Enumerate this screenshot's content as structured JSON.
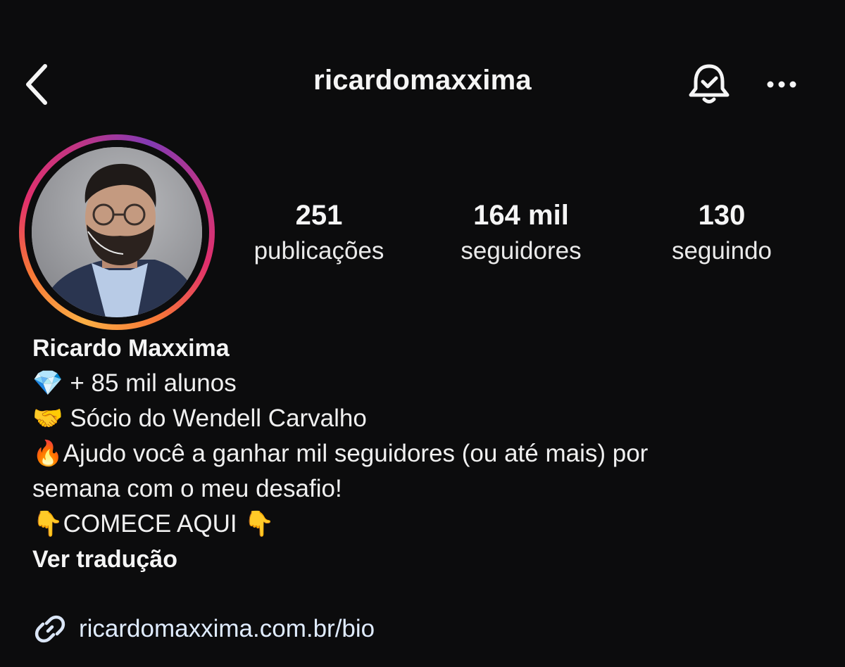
{
  "header": {
    "username": "ricardomaxxima",
    "back_icon": "chevron-left-icon",
    "notifications_icon": "bell-check-icon",
    "more_icon": "more-horizontal-icon"
  },
  "profile": {
    "avatar_ring_colors": [
      "#fcaf45",
      "#f77737",
      "#e1306c",
      "#c13584",
      "#833ab4"
    ],
    "stats": [
      {
        "value": "251",
        "label": "publicações"
      },
      {
        "value": "164 mil",
        "label": "seguidores"
      },
      {
        "value": "130",
        "label": "seguindo"
      }
    ],
    "display_name": "Ricardo Maxxima",
    "bio_lines": [
      {
        "emoji": "💎",
        "text": " + 85 mil alunos"
      },
      {
        "emoji": "🤝",
        "text": " Sócio do Wendell Carvalho"
      },
      {
        "emoji": "🔥",
        "text": "Ajudo você a ganhar mil seguidores (ou até mais) por"
      },
      {
        "emoji": "",
        "text": "semana com o meu desafio!"
      },
      {
        "emoji": "👇",
        "text": "COMECE AQUI ",
        "emoji_after": "👇"
      }
    ],
    "translate_label": "Ver tradução",
    "link_icon": "link-icon",
    "link_text": "ricardomaxxima.com.br/bio"
  },
  "colors": {
    "background": "#0c0c0d",
    "text": "#f5f5f5",
    "link": "#e0ecff"
  }
}
